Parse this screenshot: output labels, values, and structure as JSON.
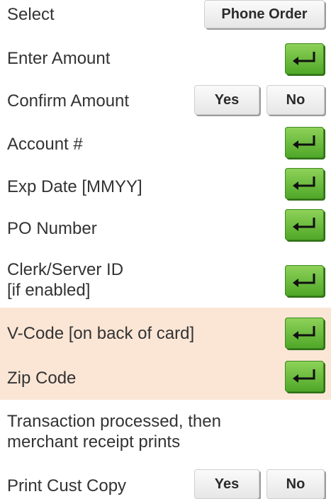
{
  "colors": {
    "highlight": "#fbe6d6",
    "enter_key": "#5fb632"
  },
  "steps": [
    {
      "label": "Select",
      "button": "Phone Order"
    },
    {
      "label": "Enter Amount",
      "icon": "enter-key-icon"
    },
    {
      "label": "Confirm Amount",
      "yes": "Yes",
      "no": "No"
    },
    {
      "label": "Account #",
      "icon": "enter-key-icon"
    },
    {
      "label": "Exp Date [MMYY]",
      "icon": "enter-key-icon"
    },
    {
      "label": "PO Number",
      "icon": "enter-key-icon"
    },
    {
      "label_line1": "Clerk/Server ID",
      "label_line2": "[if enabled]",
      "icon": "enter-key-icon"
    },
    {
      "label": "V-Code [on back of card]",
      "icon": "enter-key-icon"
    },
    {
      "label": "Zip Code",
      "icon": "enter-key-icon"
    },
    {
      "label_line1": "Transaction processed, then",
      "label_line2": "merchant receipt prints"
    },
    {
      "label": "Print Cust Copy",
      "yes": "Yes",
      "no": "No"
    }
  ]
}
